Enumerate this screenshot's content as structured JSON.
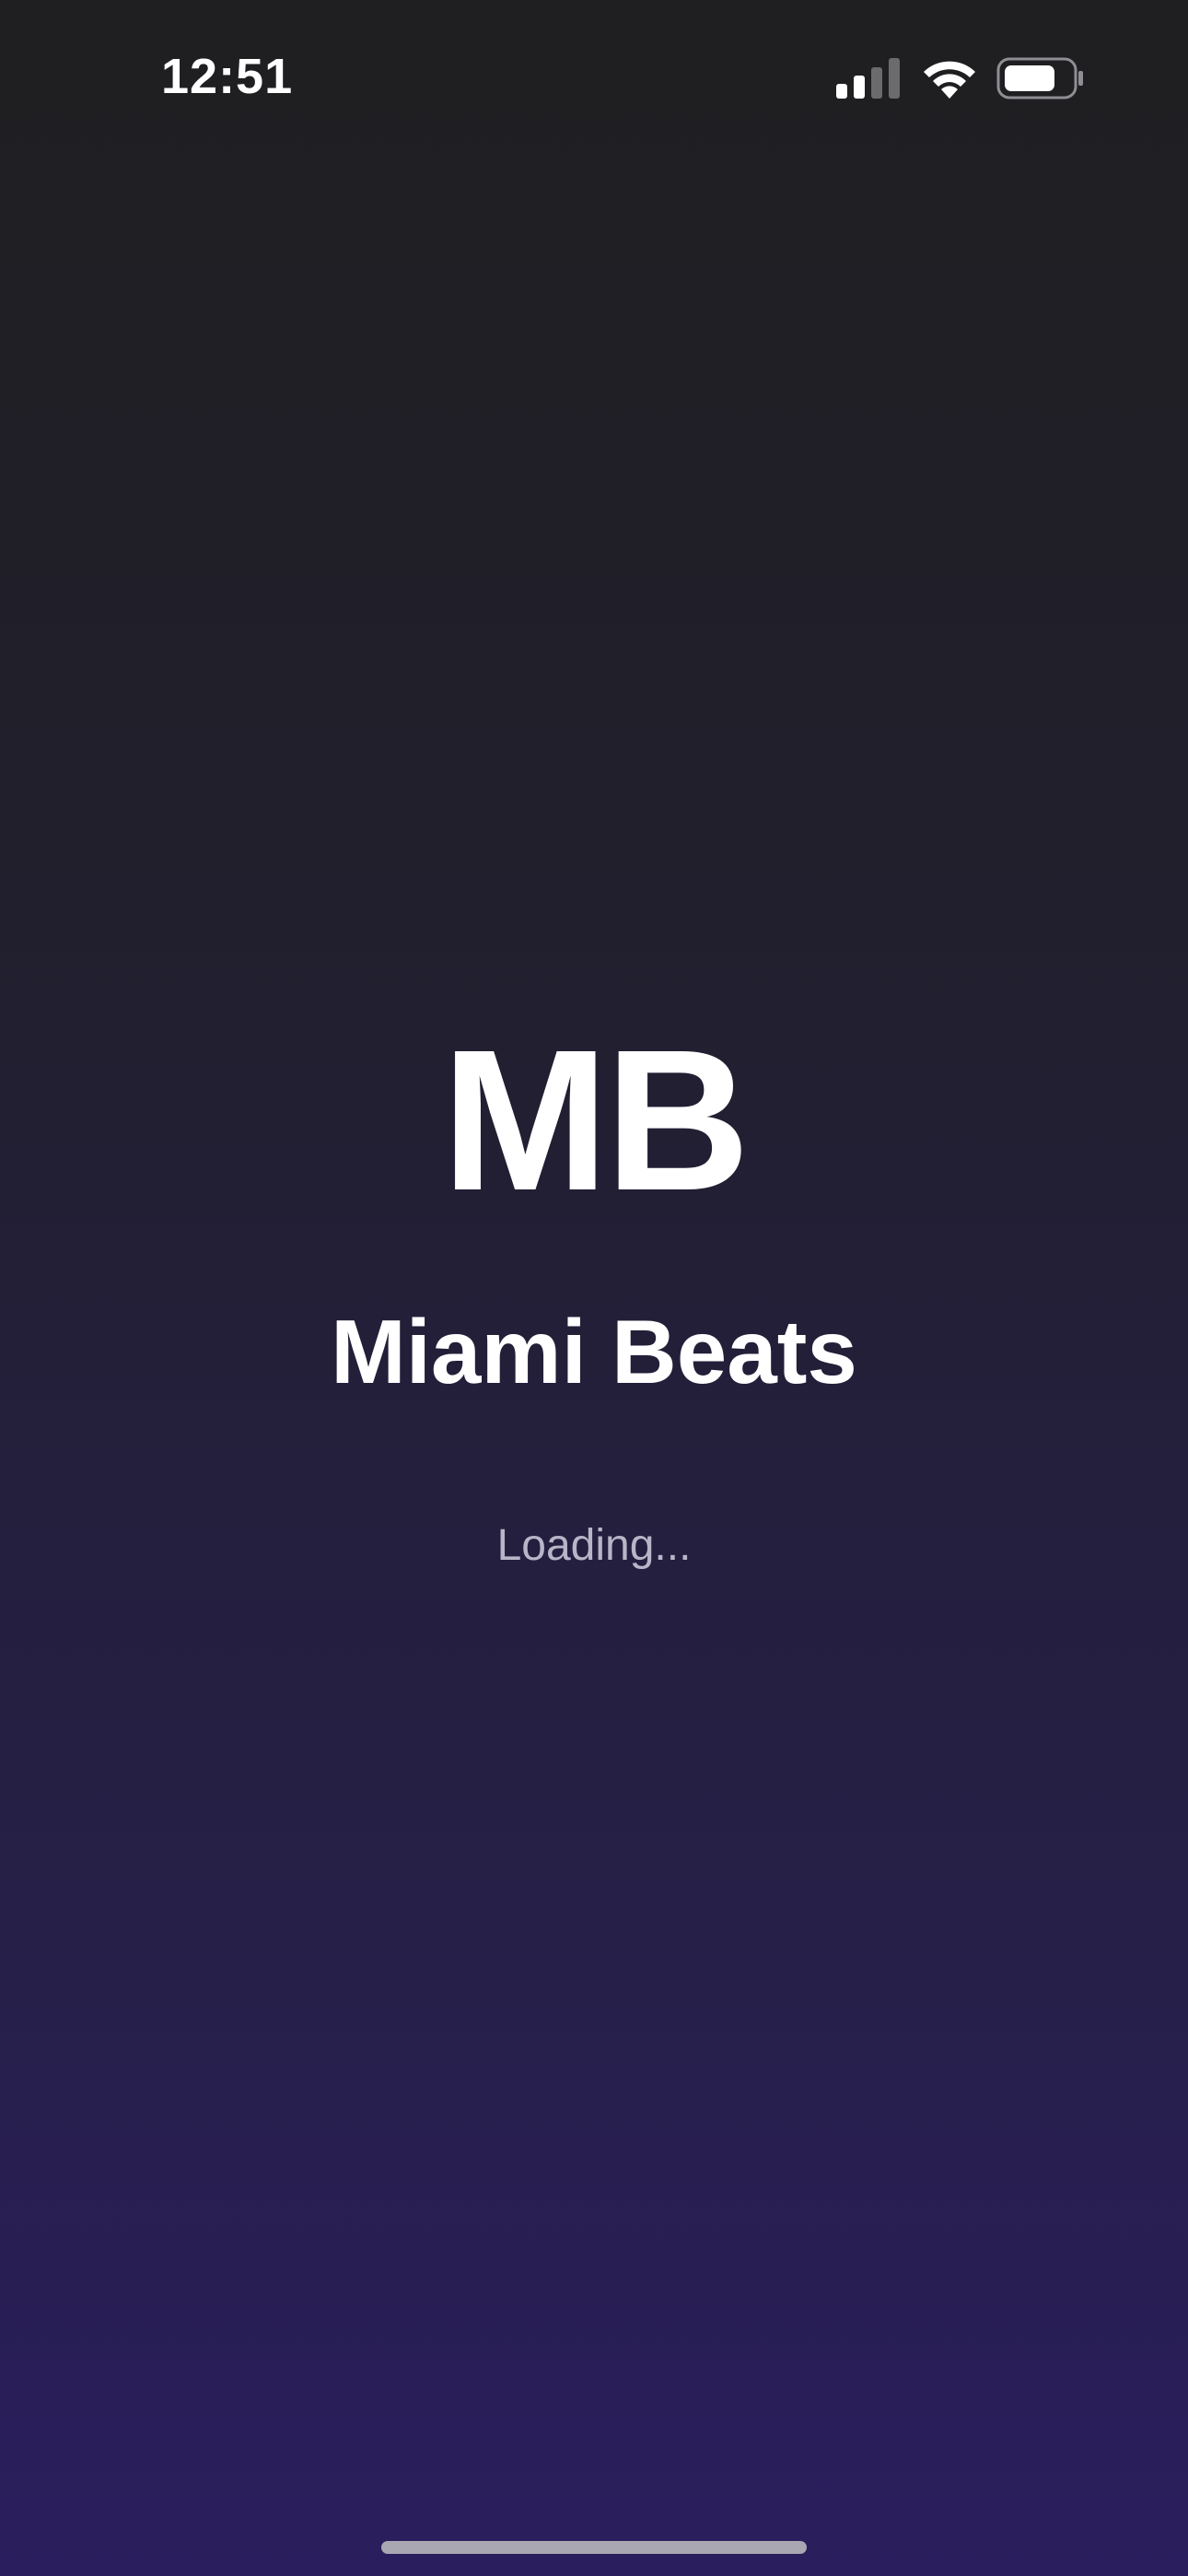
{
  "status_bar": {
    "time": "12:51",
    "icons": [
      "cellular-signal-icon",
      "wifi-icon",
      "battery-icon"
    ]
  },
  "splash": {
    "logo_text": "MB",
    "app_name": "Miami Beats",
    "loading_text": "Loading..."
  },
  "colors": {
    "background_top": "#1f1f21",
    "background_bottom": "#2a1e5e",
    "text_primary": "#ffffff",
    "text_secondary": "#b9b5c9"
  }
}
